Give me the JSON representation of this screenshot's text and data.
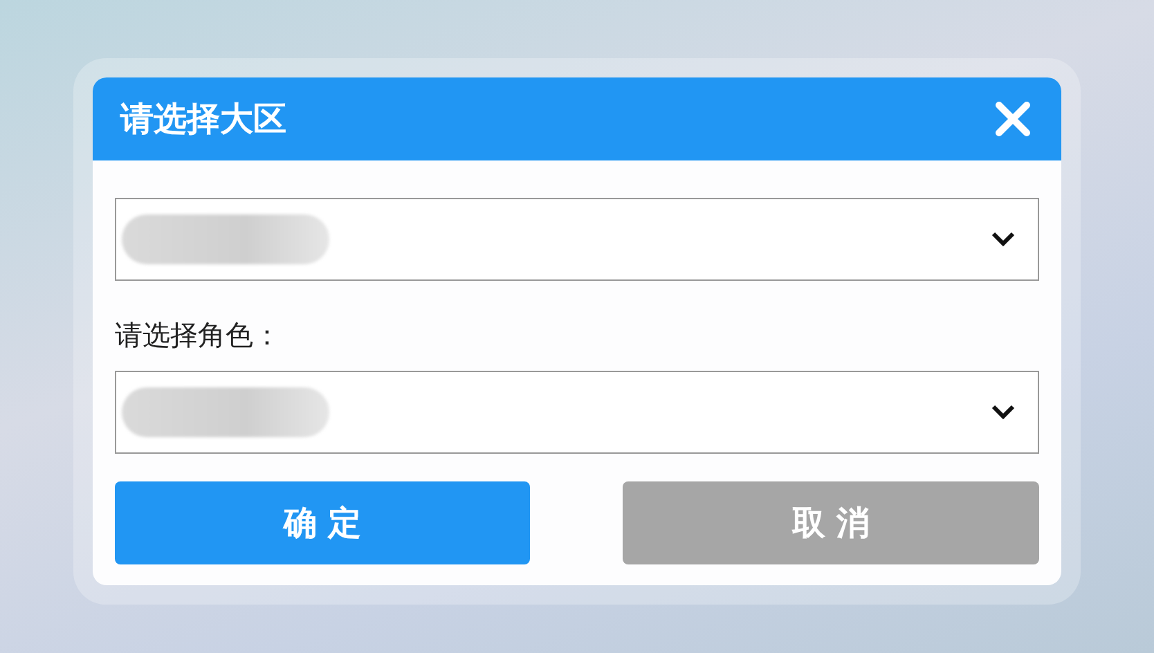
{
  "dialog": {
    "title": "请选择大区",
    "fields": [
      {
        "value_redacted": true
      },
      {
        "label": "请选择角色：",
        "value_redacted": true
      }
    ],
    "buttons": [
      {
        "label": "确 定",
        "kind": "primary"
      },
      {
        "label": "取 消",
        "kind": "secondary"
      }
    ]
  }
}
